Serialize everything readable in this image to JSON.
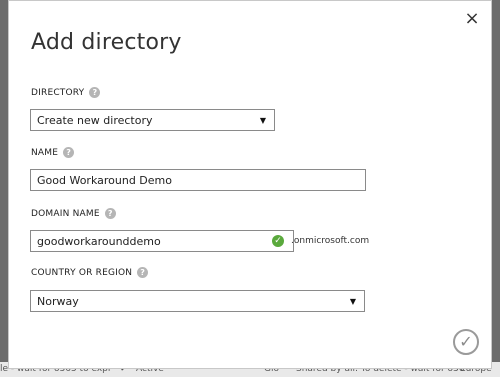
{
  "dialog": {
    "title": "Add directory",
    "close_label": "×",
    "confirm_label": "✓"
  },
  "directory": {
    "label": "DIRECTORY",
    "selected": "Create new directory"
  },
  "name": {
    "label": "NAME",
    "value": "Good Workaround Demo"
  },
  "domain": {
    "label": "DOMAIN NAME",
    "value": "goodworkarounddemo",
    "suffix": ".onmicrosoft.com"
  },
  "country": {
    "label": "COUNTRY OR REGION",
    "selected": "Norway"
  },
  "help_glyph": "?",
  "dropdown_glyph": "▼",
  "valid_glyph": "✓",
  "background": {
    "row_text_1": "le - wait for o365 to expi",
    "row_status": "Active",
    "row_text_2": "Glo",
    "row_text_3": "Shared by all: To delete - wait for o36",
    "row_text_4": "Europe"
  },
  "colors": {
    "valid": "#5aa93c",
    "help": "#b5b5b5"
  }
}
